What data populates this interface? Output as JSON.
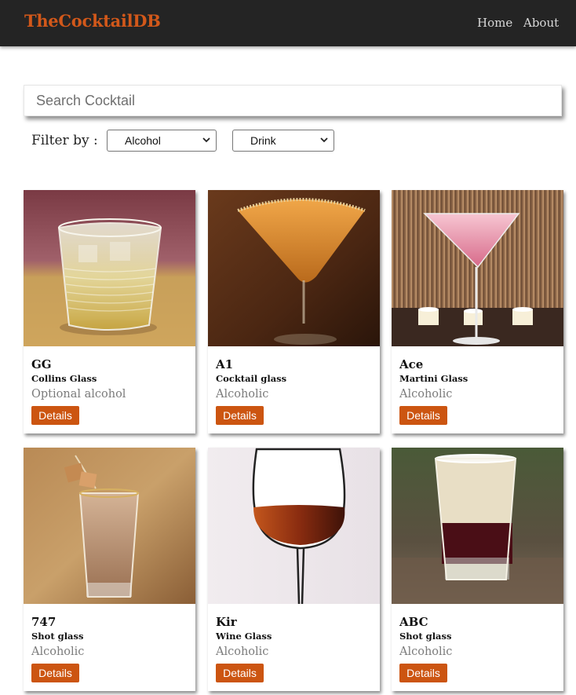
{
  "header": {
    "brand": "TheCocktailDB",
    "nav": {
      "home": "Home",
      "about": "About"
    }
  },
  "search": {
    "placeholder": "Search Cocktail",
    "value": ""
  },
  "filter": {
    "label": "Filter by :",
    "alcohol_selected": "Alcohol",
    "type_selected": "Drink"
  },
  "cards": [
    {
      "name": "GG",
      "glass": "Collins Glass",
      "alcoholic": "Optional alcohol",
      "button": "Details",
      "image": "collins-glass-cocktail-photo"
    },
    {
      "name": "A1",
      "glass": "Cocktail glass",
      "alcoholic": "Alcoholic",
      "button": "Details",
      "image": "orange-martini-photo"
    },
    {
      "name": "Ace",
      "glass": "Martini Glass",
      "alcoholic": "Alcoholic",
      "button": "Details",
      "image": "pink-martini-photo"
    },
    {
      "name": "747",
      "glass": "Shot glass",
      "alcoholic": "Alcoholic",
      "button": "Details",
      "image": "caramel-shot-photo"
    },
    {
      "name": "Kir",
      "glass": "Wine Glass",
      "alcoholic": "Alcoholic",
      "button": "Details",
      "image": "wine-glass-photo"
    },
    {
      "name": "ABC",
      "glass": "Shot glass",
      "alcoholic": "Alcoholic",
      "button": "Details",
      "image": "layered-shot-photo"
    }
  ],
  "colors": {
    "accent": "#cc5511",
    "brand": "#d2581a",
    "navbar": "#242424"
  }
}
